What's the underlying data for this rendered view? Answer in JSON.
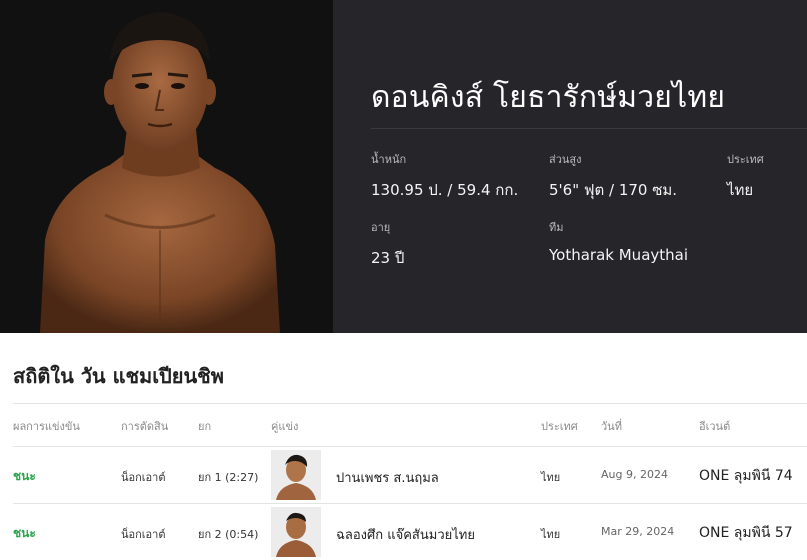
{
  "athlete": {
    "name": "ดอนคิงส์ โยธารักษ์มวยไทย",
    "stats": {
      "weight_label": "น้ำหนัก",
      "weight_value": "130.95 ป. / 59.4 กก.",
      "height_label": "ส่วนสูง",
      "height_value": "5'6\" ฟุต / 170 ซม.",
      "country_label": "ประเทศ",
      "country_value": "ไทย",
      "age_label": "อายุ",
      "age_value": "23 ปี",
      "team_label": "ทีม",
      "team_value": "Yotharak Muaythai"
    }
  },
  "section": {
    "title": "สถิติใน วัน แชมเปียนชิพ"
  },
  "table": {
    "headers": {
      "result": "ผลการแข่งขัน",
      "method": "การตัดสิน",
      "round": "ยก",
      "opponent": "คู่แข่ง",
      "country": "ประเทศ",
      "date": "วันที่",
      "event": "อีเวนต์"
    },
    "rows": [
      {
        "result": "ชนะ",
        "method": "น็อกเอาต์",
        "round": "ยก 1 (2:27)",
        "opponent": "ปานเพชร ส.นฤมล",
        "country": "ไทย",
        "date": "Aug 9, 2024",
        "event": "ONE ลุมพินี 74"
      },
      {
        "result": "ชนะ",
        "method": "น็อกเอาต์",
        "round": "ยก 2 (0:54)",
        "opponent": "ฉลองศึก แจ๊คสันมวยไทย",
        "country": "ไทย",
        "date": "Mar 29, 2024",
        "event": "ONE ลุมพินี 57"
      }
    ]
  },
  "colors": {
    "photo_bg": "#111111",
    "info_bg": "#25252a",
    "win": "#2ea24f"
  }
}
